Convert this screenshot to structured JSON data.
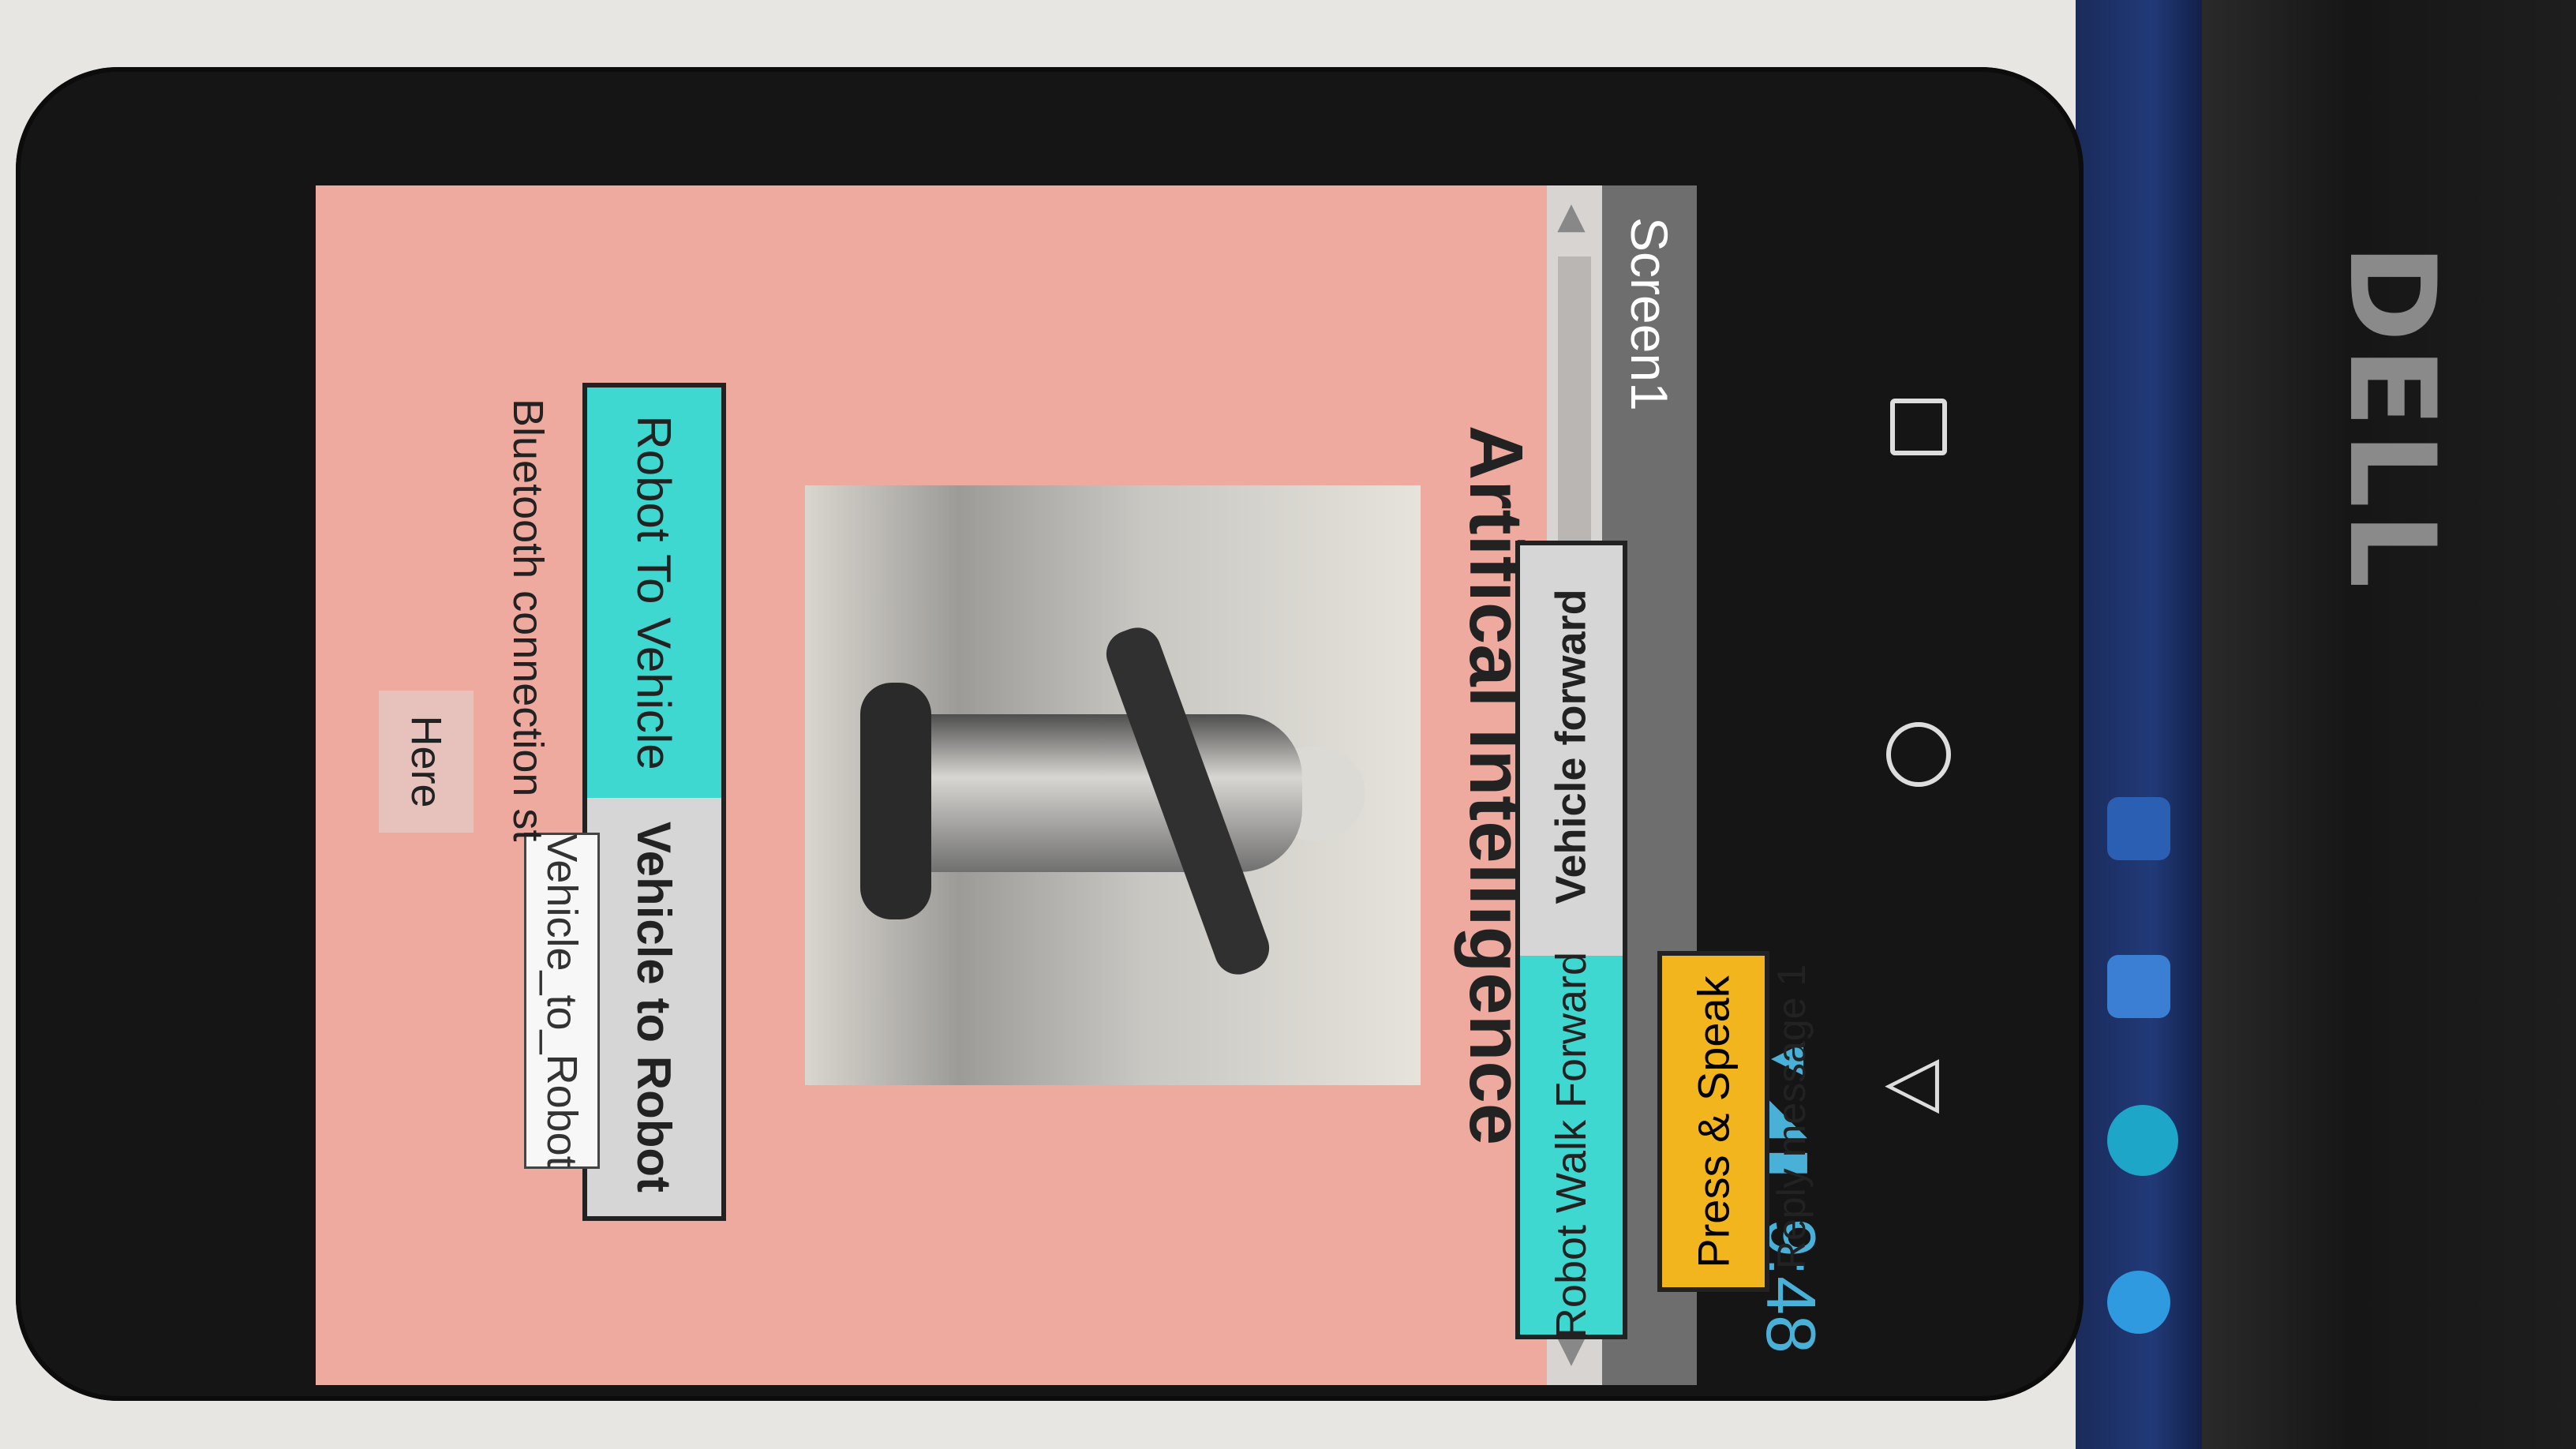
{
  "status_bar": {
    "time": "9:48"
  },
  "app": {
    "screen_title": "Screen1",
    "title": "Artifical Intelligence",
    "buttons": {
      "robot_to_vehicle": "Robot To Vehicle",
      "vehicle_to_robot": "Vehicle to Robot",
      "robot_walk_forward": "Robot Walk Forward",
      "vehicle_forward": "Vehicle forward",
      "press_speak": "Press & Speak"
    },
    "tooltip": "Vehicle_to_Robot",
    "bluetooth_status": "Bluetooth connection st",
    "here_label": "Here",
    "reply_message": "Reply message 1"
  },
  "colors": {
    "screen_bg": "#efaaa0",
    "button_cyan": "#3fd8d0",
    "button_orange": "#f2b51e",
    "status_blue": "#49b0d8"
  },
  "monitor": {
    "brand": "DELL"
  }
}
